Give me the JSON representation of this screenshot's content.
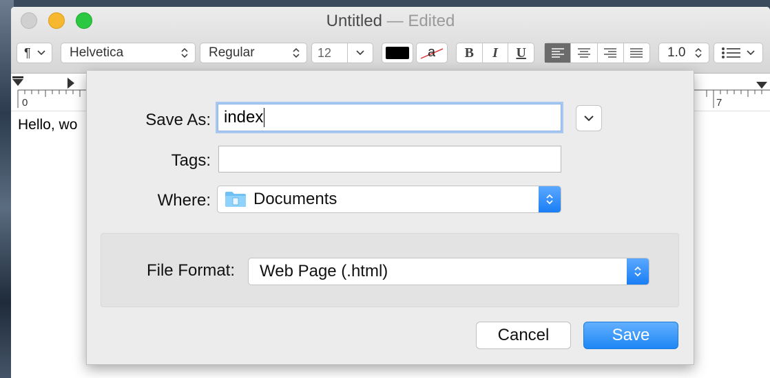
{
  "window": {
    "title": "Untitled",
    "separator": "—",
    "status": "Edited"
  },
  "toolbar": {
    "paragraph_style": "¶",
    "font_family": "Helvetica",
    "font_style": "Regular",
    "font_size": "12",
    "text_color": "#000000",
    "highlight_label": "a",
    "bold": "B",
    "italic": "I",
    "underline": "U",
    "line_spacing": "1.0"
  },
  "ruler": {
    "tick_start": "0",
    "tick_end": "7"
  },
  "document": {
    "text": "Hello, wo"
  },
  "save_dialog": {
    "save_as_label": "Save As:",
    "save_as_value": "index",
    "tags_label": "Tags:",
    "tags_value": "",
    "where_label": "Where:",
    "where_value": "Documents",
    "file_format_label": "File Format:",
    "file_format_value": "Web Page (.html)",
    "cancel_label": "Cancel",
    "save_label": "Save"
  },
  "colors": {
    "accent": "#1d86f5",
    "focus_ring": "#a8c8f0"
  }
}
